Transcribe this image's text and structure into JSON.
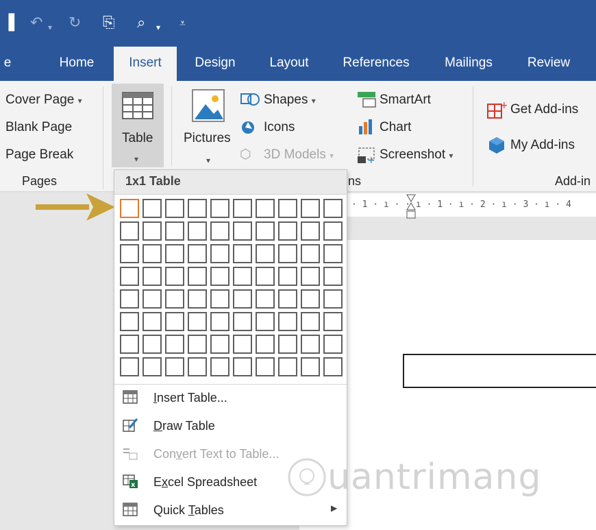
{
  "tabs": [
    {
      "label": "e",
      "active": false
    },
    {
      "label": "Home",
      "active": false
    },
    {
      "label": "Insert",
      "active": true
    },
    {
      "label": "Design",
      "active": false
    },
    {
      "label": "Layout",
      "active": false
    },
    {
      "label": "References",
      "active": false
    },
    {
      "label": "Mailings",
      "active": false
    },
    {
      "label": "Review",
      "active": false
    }
  ],
  "ribbon": {
    "pages": {
      "cover_page": "Cover Page",
      "blank_page": "Blank Page",
      "page_break": "Page Break",
      "group_label": "Pages"
    },
    "tables": {
      "table": "Table"
    },
    "illustrations": {
      "pictures": "Pictures",
      "shapes": "Shapes",
      "icons": "Icons",
      "models_3d": "3D Models",
      "smartart": "SmartArt",
      "chart": "Chart",
      "screenshot": "Screenshot",
      "group_label_fragment": "ns"
    },
    "addins": {
      "get_addins": "Get Add-ins",
      "my_addins": "My Add-ins",
      "group_label_fragment": "Add-in"
    }
  },
  "ruler": {
    "text": "· 1 · ı ·  · ı · 1 · ı · 2 · ı · 3 · ı · 4"
  },
  "dropdown": {
    "header": "1x1 Table",
    "grid": {
      "cols": 10,
      "rows": 8,
      "selected_cols": 1,
      "selected_rows": 1
    },
    "items": [
      {
        "pre": "",
        "key": "I",
        "post": "nsert Table...",
        "enabled": true,
        "icon": "insert-table-icon"
      },
      {
        "pre": "",
        "key": "D",
        "post": "raw Table",
        "enabled": true,
        "icon": "draw-table-icon"
      },
      {
        "pre": "Con",
        "key": "v",
        "post": "ert Text to Table...",
        "enabled": false,
        "icon": "convert-text-icon"
      },
      {
        "pre": "E",
        "key": "x",
        "post": "cel Spreadsheet",
        "enabled": true,
        "icon": "excel-spreadsheet-icon"
      },
      {
        "pre": "Quick ",
        "key": "T",
        "post": "ables",
        "enabled": true,
        "icon": "quick-tables-icon"
      }
    ]
  },
  "watermark": {
    "text": "uantrimang"
  },
  "colors": {
    "titlebar": "#2b579a",
    "ribbon_bg": "#f3f3f3",
    "grid_border": "#5f5f5f",
    "selected_cell": "#e8782c",
    "arrow": "#c9a23a"
  }
}
